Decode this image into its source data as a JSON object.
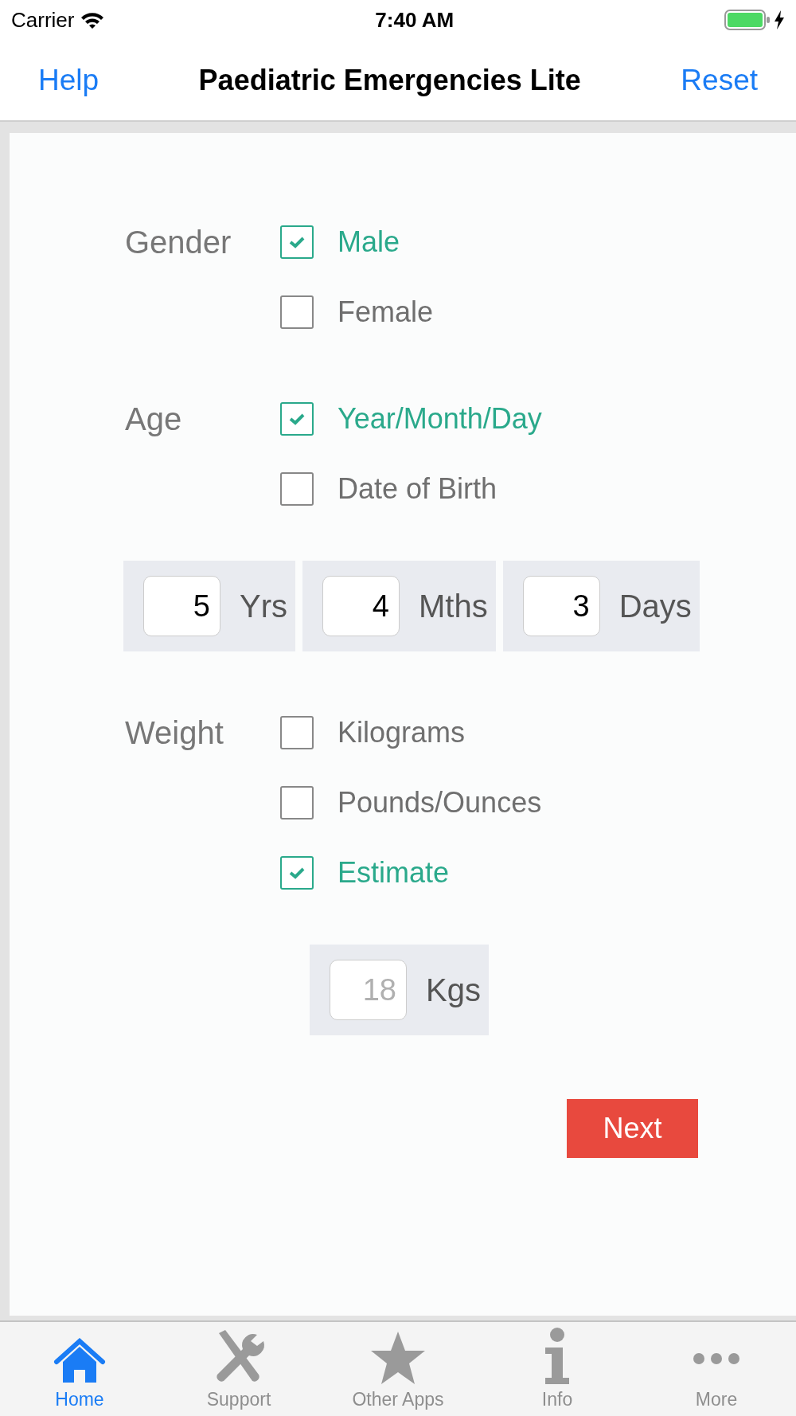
{
  "status_bar": {
    "carrier": "Carrier",
    "time": "7:40 AM"
  },
  "nav": {
    "left_button": "Help",
    "title": "Paediatric Emergencies Lite",
    "right_button": "Reset"
  },
  "sections": [
    {
      "label": "Gender",
      "options": [
        {
          "label": "Male",
          "checked": true
        },
        {
          "label": "Female",
          "checked": false
        }
      ]
    },
    {
      "label": "Age",
      "options": [
        {
          "label": "Year/Month/Day",
          "checked": true
        },
        {
          "label": "Date of Birth",
          "checked": false
        }
      ],
      "fields": [
        {
          "value": "5",
          "unit": "Yrs"
        },
        {
          "value": "4",
          "unit": "Mths"
        },
        {
          "value": "3",
          "unit": "Days"
        }
      ]
    },
    {
      "label": "Weight",
      "options": [
        {
          "label": "Kilograms",
          "checked": false
        },
        {
          "label": "Pounds/Ounces",
          "checked": false
        },
        {
          "label": "Estimate",
          "checked": true
        }
      ],
      "fields": [
        {
          "placeholder": "18",
          "unit": "Kgs"
        }
      ]
    }
  ],
  "next_button": "Next",
  "tabs": [
    {
      "label": "Home",
      "kind": "home",
      "selected": true
    },
    {
      "label": "Support",
      "kind": "tools",
      "selected": false
    },
    {
      "label": "Other Apps",
      "kind": "star",
      "selected": false
    },
    {
      "label": "Info",
      "kind": "info",
      "selected": false
    },
    {
      "label": "More",
      "kind": "more",
      "selected": false
    }
  ]
}
